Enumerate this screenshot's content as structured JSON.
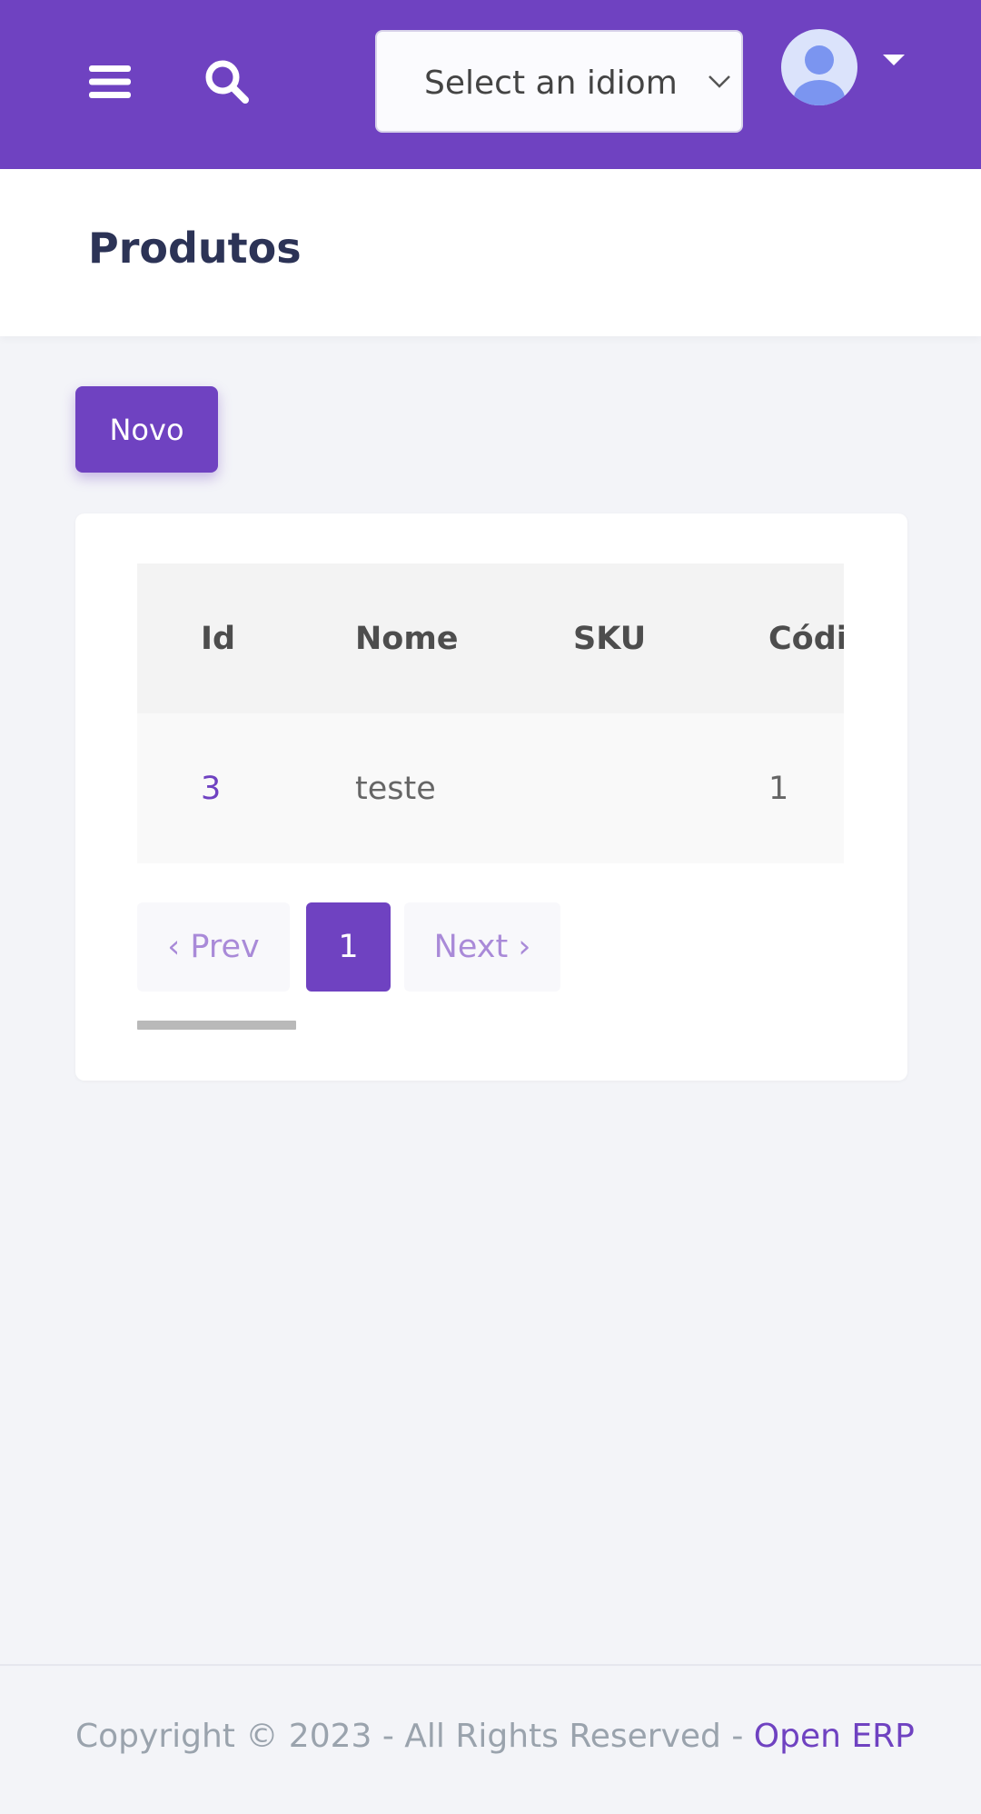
{
  "header": {
    "menu_icon": "hamburger-menu-icon",
    "search_icon": "search-icon",
    "idiom_select": {
      "value": "Select an idiom",
      "icon": "chevron-down-icon"
    },
    "user": {
      "avatar_icon": "user-avatar-icon",
      "caret_icon": "caret-down-icon"
    },
    "colors": {
      "bar": "#6f42c1"
    }
  },
  "page": {
    "title": "Produtos"
  },
  "actions": {
    "new_label": "Novo"
  },
  "table": {
    "columns": [
      "Id",
      "Nome",
      "SKU",
      "Códi"
    ],
    "rows": [
      {
        "id": "3",
        "nome": "teste",
        "sku": "",
        "codigo": "1"
      }
    ]
  },
  "pagination": {
    "prev_label": "‹ Prev",
    "current_page": "1",
    "next_label": "Next ›"
  },
  "footer": {
    "text": "Copyright © 2023 - All Rights Reserved - ",
    "link": "Open ERP"
  }
}
